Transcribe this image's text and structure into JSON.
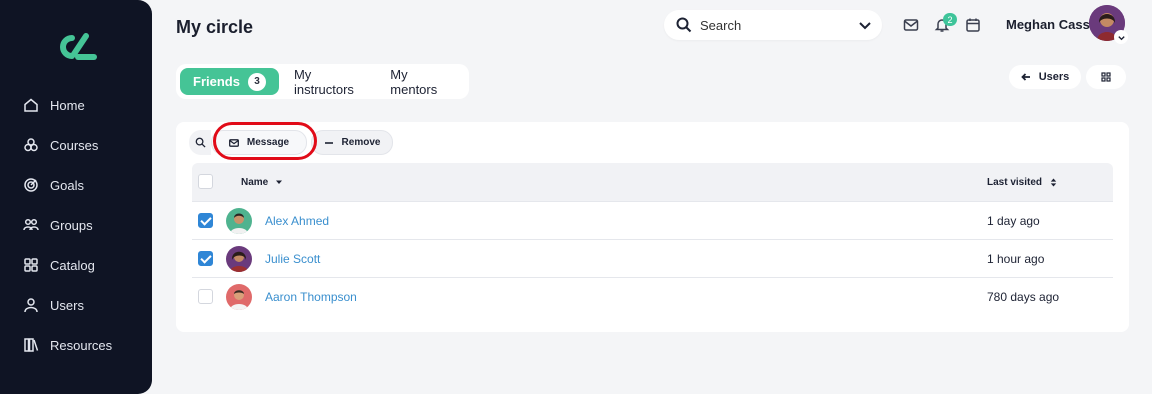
{
  "sidebar": {
    "items": [
      {
        "label": "Home",
        "icon": "home-icon"
      },
      {
        "label": "Courses",
        "icon": "courses-icon"
      },
      {
        "label": "Goals",
        "icon": "goals-icon"
      },
      {
        "label": "Groups",
        "icon": "groups-icon"
      },
      {
        "label": "Catalog",
        "icon": "catalog-icon"
      },
      {
        "label": "Users",
        "icon": "user-icon"
      },
      {
        "label": "Resources",
        "icon": "resources-icon"
      }
    ]
  },
  "header": {
    "title": "My circle",
    "search_placeholder": "Search",
    "notification_count": "2",
    "user_name": "Meghan Cass"
  },
  "tabs": {
    "friends_label": "Friends",
    "friends_count": "3",
    "instructors_label": "My instructors",
    "mentors_label": "My mentors"
  },
  "actions": {
    "users_label": "Users"
  },
  "toolbar": {
    "message_label": "Message",
    "remove_label": "Remove"
  },
  "table": {
    "col_name": "Name",
    "col_last_visited": "Last visited",
    "rows": [
      {
        "name": "Alex Ahmed",
        "last_visited": "1 day ago",
        "checked": true
      },
      {
        "name": "Julie Scott",
        "last_visited": "1 hour ago",
        "checked": true
      },
      {
        "name": "Aaron Thompson",
        "last_visited": "780 days ago",
        "checked": false
      }
    ]
  },
  "colors": {
    "sidebar_bg": "#0f1424",
    "accent_green": "#45c496",
    "link_blue": "#3a8fce",
    "checkbox_blue": "#2f86d6",
    "highlight_red": "#e10b18"
  }
}
